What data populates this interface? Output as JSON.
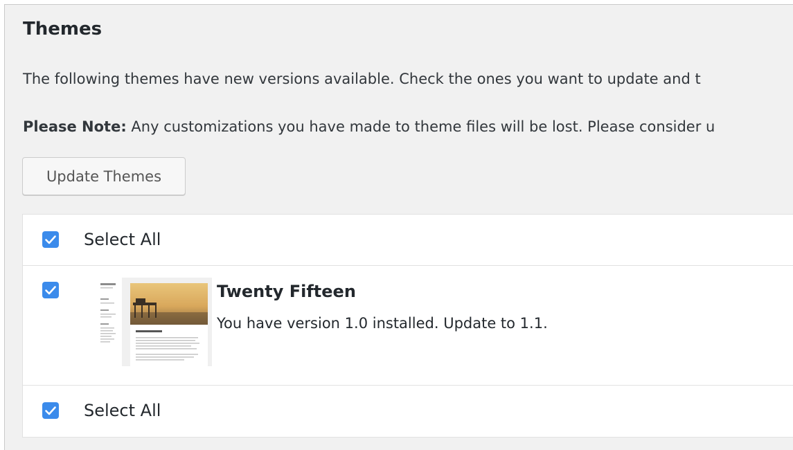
{
  "section": {
    "title": "Themes",
    "intro_text": "The following themes have new versions available. Check the ones you want to update and t",
    "note_label": "Please Note:",
    "note_text": " Any customizations you have made to theme files will be lost. Please consider u"
  },
  "actions": {
    "update_button_label": "Update Themes"
  },
  "table": {
    "select_all_top": {
      "label": "Select All",
      "checked": true
    },
    "select_all_bottom": {
      "label": "Select All",
      "checked": true
    },
    "themes": [
      {
        "name": "Twenty Fifteen",
        "version_text": "You have version 1.0 installed. Update to 1.1.",
        "checked": true,
        "screenshot_icon": "theme-screenshot-thumbnail"
      }
    ]
  },
  "colors": {
    "page_background": "#f1f1f1",
    "checkbox_checked": "#3b8beb",
    "text_primary": "#23282d"
  }
}
